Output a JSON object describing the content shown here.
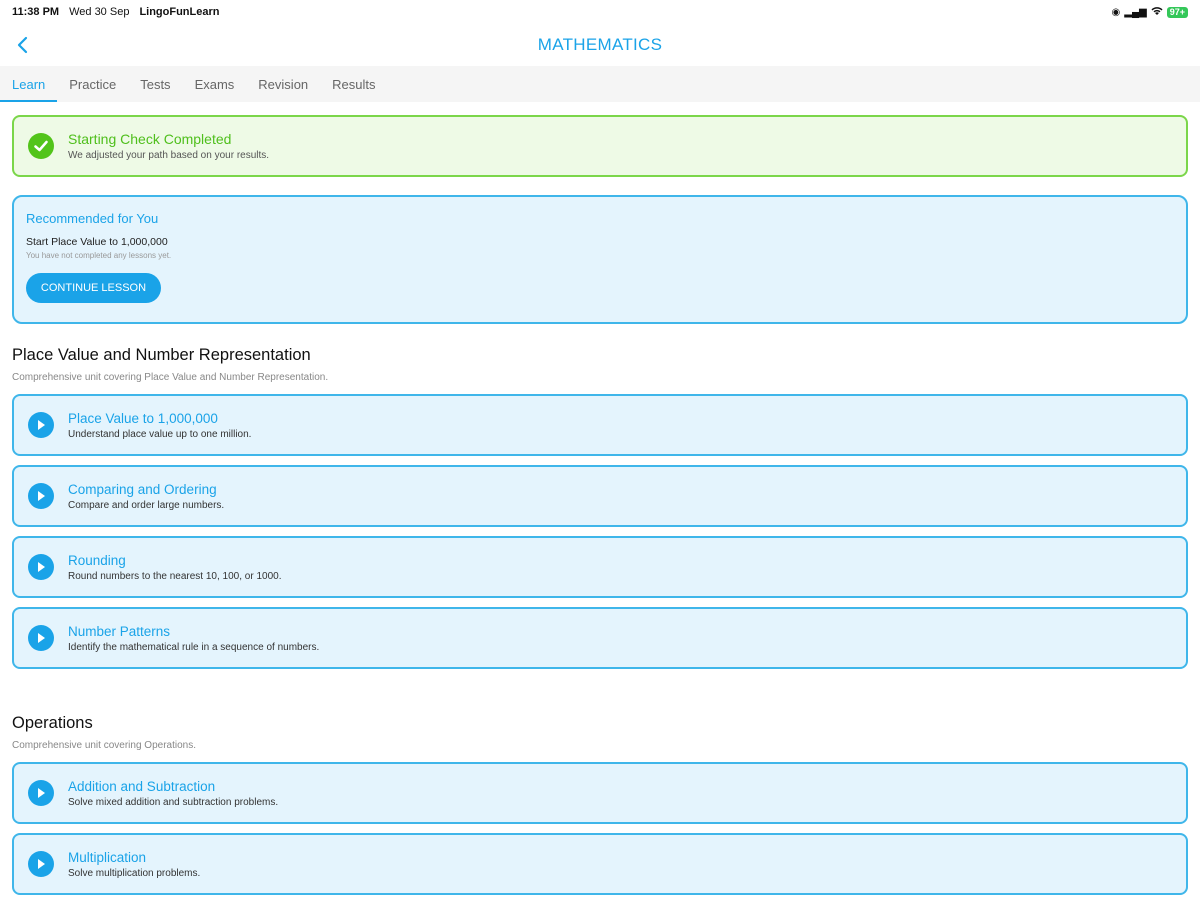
{
  "status": {
    "time": "11:38 PM",
    "date": "Wed 30 Sep",
    "app": "LingoFunLearn",
    "battery": "97+"
  },
  "header": {
    "title": "MATHEMATICS"
  },
  "tabs": [
    {
      "label": "Learn",
      "active": true
    },
    {
      "label": "Practice"
    },
    {
      "label": "Tests"
    },
    {
      "label": "Exams"
    },
    {
      "label": "Revision"
    },
    {
      "label": "Results"
    }
  ],
  "banner": {
    "title": "Starting Check Completed",
    "text": "We adjusted your path based on your results."
  },
  "recommend": {
    "title": "Recommended for You",
    "subtitle": "Start Place Value to 1,000,000",
    "note": "You have not completed any lessons yet.",
    "button": "CONTINUE LESSON"
  },
  "units": [
    {
      "title": "Place Value and Number Representation",
      "subtitle": "Comprehensive unit covering Place Value and Number Representation.",
      "lessons": [
        {
          "title": "Place Value to 1,000,000",
          "desc": "Understand place value up to one million."
        },
        {
          "title": "Comparing and Ordering",
          "desc": "Compare and order large numbers."
        },
        {
          "title": "Rounding",
          "desc": "Round numbers to the nearest 10, 100, or 1000."
        },
        {
          "title": "Number Patterns",
          "desc": "Identify the mathematical rule in a sequence of numbers."
        }
      ]
    },
    {
      "title": "Operations",
      "subtitle": "Comprehensive unit covering Operations.",
      "lessons": [
        {
          "title": "Addition and Subtraction",
          "desc": "Solve mixed addition and subtraction problems."
        },
        {
          "title": "Multiplication",
          "desc": "Solve multiplication problems."
        }
      ]
    }
  ],
  "colors": {
    "accent": "#1aa3e8",
    "success": "#52c41a",
    "card_bg": "#e4f4fd"
  }
}
